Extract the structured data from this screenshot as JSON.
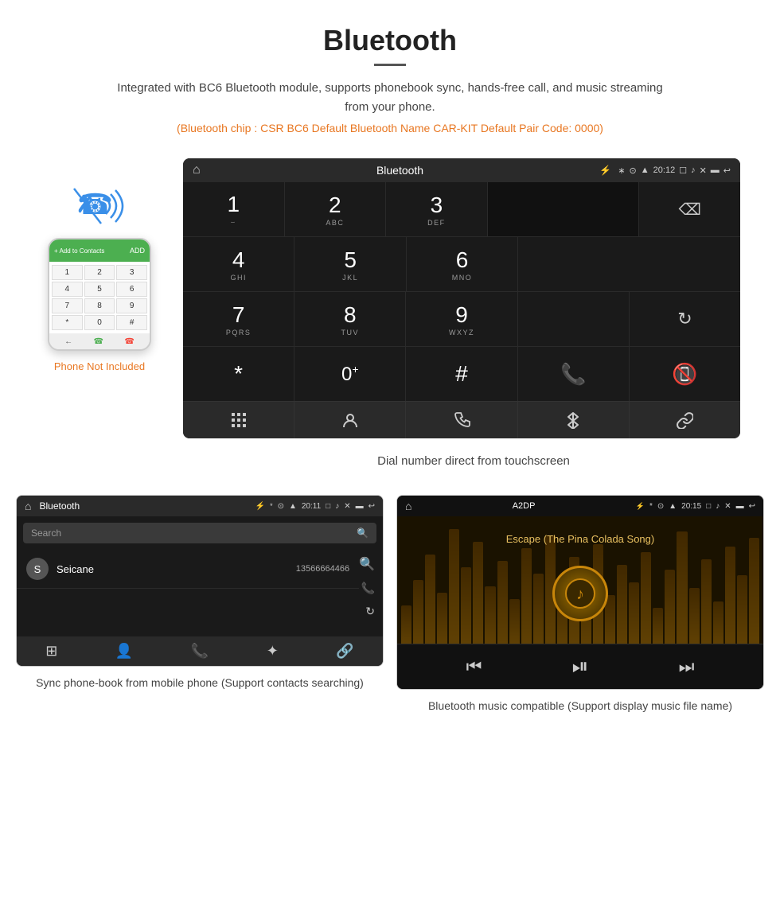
{
  "header": {
    "title": "Bluetooth",
    "description": "Integrated with BC6 Bluetooth module, supports phonebook sync, hands-free call, and music streaming from your phone.",
    "info_line": "(Bluetooth chip : CSR BC6    Default Bluetooth Name CAR-KIT    Default Pair Code: 0000)"
  },
  "phone_label": "Phone Not Included",
  "dial_screen": {
    "status_bar": {
      "title": "Bluetooth",
      "time": "20:12"
    },
    "keypad": [
      {
        "num": "1",
        "sub": ""
      },
      {
        "num": "2",
        "sub": "ABC"
      },
      {
        "num": "3",
        "sub": "DEF"
      },
      {
        "num": "4",
        "sub": "GHI"
      },
      {
        "num": "5",
        "sub": "JKL"
      },
      {
        "num": "6",
        "sub": "MNO"
      },
      {
        "num": "7",
        "sub": "PQRS"
      },
      {
        "num": "8",
        "sub": "TUV"
      },
      {
        "num": "9",
        "sub": "WXYZ"
      },
      {
        "num": "*",
        "sub": ""
      },
      {
        "num": "0",
        "sub": "+"
      },
      {
        "num": "#",
        "sub": ""
      }
    ]
  },
  "dial_caption": "Dial number direct from touchscreen",
  "phonebook": {
    "status_time": "20:11",
    "title": "Bluetooth",
    "search_placeholder": "Search",
    "contact_letter": "S",
    "contact_name": "Seicane",
    "contact_phone": "13566664466"
  },
  "phonebook_caption": "Sync phone-book from mobile phone\n(Support contacts searching)",
  "music": {
    "status_time": "20:15",
    "title": "A2DP",
    "song_name": "Escape (The Pina Colada Song)"
  },
  "music_caption": "Bluetooth music compatible\n(Support display music file name)",
  "phone_keys": [
    "1",
    "2",
    "3",
    "4",
    "5",
    "6",
    "7",
    "8",
    "9",
    "*",
    "0",
    "#"
  ],
  "colors": {
    "orange": "#e87722",
    "green": "#4caf50",
    "red": "#f44336",
    "blue": "#3a8fe8",
    "gold": "#c8860a"
  }
}
